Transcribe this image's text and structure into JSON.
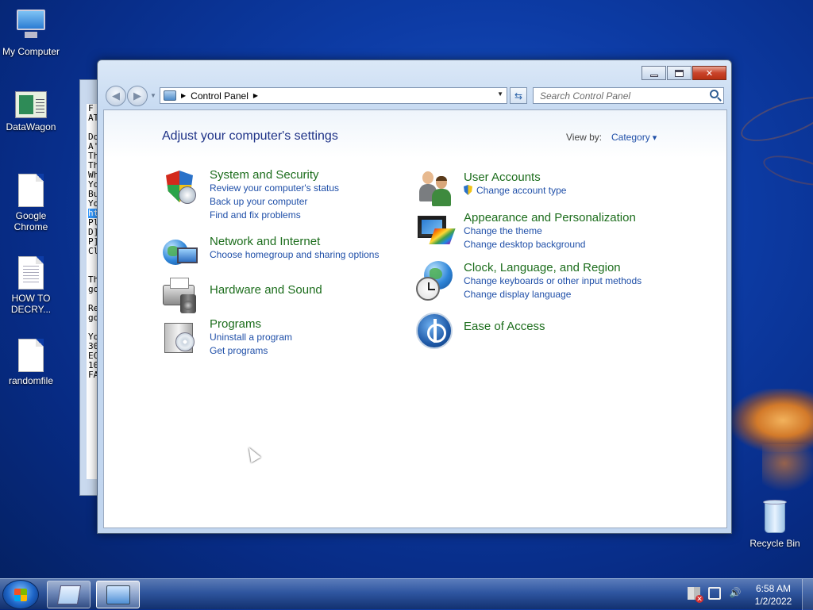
{
  "desktop": {
    "icons": [
      {
        "label": "My Computer"
      },
      {
        "label": "DataWagon"
      },
      {
        "label": "Google Chrome"
      },
      {
        "label": "HOW TO DECRY..."
      },
      {
        "label": "randomfile"
      }
    ],
    "recycle_bin": "Recycle Bin"
  },
  "background_window": {
    "visible_text": [
      "F",
      "AT",
      "",
      "Do",
      "A'",
      "Th",
      "Th",
      "Wh",
      "Yo",
      "Bu",
      "Yo",
      "ht",
      "Pl",
      "D]",
      "P]",
      "Cl",
      "",
      "",
      "Th",
      "go",
      "",
      "Re",
      "go",
      "",
      "Yo",
      "30",
      "EC",
      "10",
      "FA"
    ]
  },
  "window": {
    "address": {
      "segment": "Control Panel"
    },
    "search_placeholder": "Search Control Panel",
    "heading": "Adjust your computer's settings",
    "view_by_label": "View by:",
    "view_by_value": "Category",
    "categories_left": [
      {
        "title": "System and Security",
        "links": [
          "Review your computer's status",
          "Back up your computer",
          "Find and fix problems"
        ]
      },
      {
        "title": "Network and Internet",
        "links": [
          "Choose homegroup and sharing options"
        ]
      },
      {
        "title": "Hardware and Sound",
        "links": []
      },
      {
        "title": "Programs",
        "links": [
          "Uninstall a program",
          "Get programs"
        ]
      }
    ],
    "categories_right": [
      {
        "title": "User Accounts",
        "links": [
          "Change account type"
        ]
      },
      {
        "title": "Appearance and Personalization",
        "links": [
          "Change the theme",
          "Change desktop background"
        ]
      },
      {
        "title": "Clock, Language, and Region",
        "links": [
          "Change keyboards or other input methods",
          "Change display language"
        ]
      },
      {
        "title": "Ease of Access",
        "links": []
      }
    ]
  },
  "taskbar": {
    "time": "6:58 AM",
    "date": "1/2/2022"
  }
}
